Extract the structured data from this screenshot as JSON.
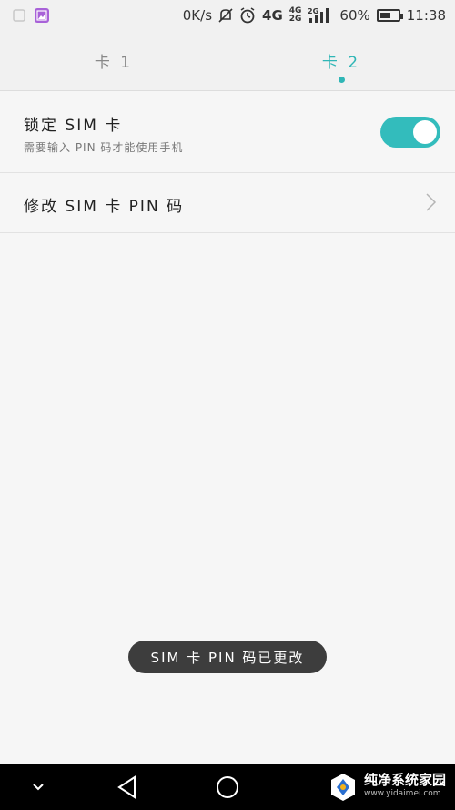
{
  "statusbar": {
    "speed": "0K/s",
    "net_4g": "4G",
    "net_4g_2g_top": "4G",
    "net_4g_2g_bottom": "2G",
    "net_2g": "2G",
    "battery_text": "60%",
    "battery_level": 0.6,
    "time": "11:38",
    "icons": [
      "notification-icon",
      "gallery-icon",
      "mute-icon",
      "alarm-icon",
      "signal-icon",
      "battery-icon"
    ]
  },
  "tabs": [
    {
      "label": "卡 1",
      "active": false
    },
    {
      "label": "卡 2",
      "active": true
    }
  ],
  "settings": {
    "lock_sim": {
      "title": "锁定 SIM 卡",
      "subtitle": "需要输入 PIN 码才能使用手机",
      "enabled": true
    },
    "change_pin": {
      "title": "修改 SIM 卡 PIN 码"
    }
  },
  "toast": "SIM 卡 PIN 码已更改",
  "navbar": {
    "icons": [
      "chevron-down-icon",
      "back-icon",
      "home-icon"
    ]
  },
  "watermark": {
    "name": "纯净系统家园",
    "url": "www.yidaimei.com"
  },
  "colors": {
    "accent": "#2fb6b6",
    "toggle_on": "#33bcbc",
    "toast_bg": "#3d3d3d"
  }
}
